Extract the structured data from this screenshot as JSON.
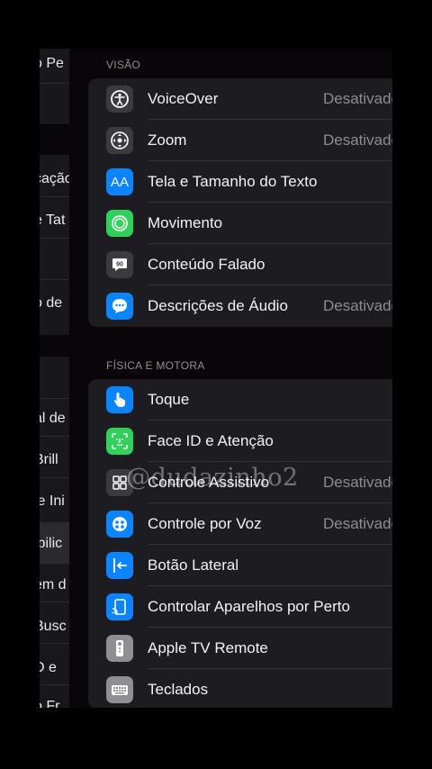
{
  "sidebar": {
    "items": [
      {
        "label": "o Pe"
      },
      {
        "label": "cação"
      },
      {
        "label": "e Tat"
      },
      {
        "label": "o de"
      },
      {
        "label": "al de"
      },
      {
        "label": "Brill"
      },
      {
        "label": "le Ini"
      },
      {
        "label": "ibilic"
      },
      {
        "label": "em d"
      },
      {
        "label": "Busc"
      },
      {
        "label": "D e"
      },
      {
        "label": "o Fr"
      }
    ]
  },
  "sections": [
    {
      "header": "VISÃO",
      "rows": [
        {
          "label": "VoiceOver",
          "value": "Desativado",
          "icon": "voiceover-icon",
          "color": "#3a3a3f"
        },
        {
          "label": "Zoom",
          "value": "Desativado",
          "icon": "zoom-icon",
          "color": "#3a3a3f"
        },
        {
          "label": "Tela e Tamanho do Texto",
          "value": "",
          "icon": "text-size-icon",
          "color": "#0a84ff"
        },
        {
          "label": "Movimento",
          "value": "",
          "icon": "motion-icon",
          "color": "#30d158"
        },
        {
          "label": "Conteúdo Falado",
          "value": "",
          "icon": "spoken-content-icon",
          "color": "#3a3a3f"
        },
        {
          "label": "Descrições de Áudio",
          "value": "Desativado",
          "icon": "audio-description-icon",
          "color": "#0a84ff"
        }
      ]
    },
    {
      "header": "FÍSICA E MOTORA",
      "rows": [
        {
          "label": "Toque",
          "value": "",
          "icon": "touch-icon",
          "color": "#0a84ff"
        },
        {
          "label": "Face ID e Atenção",
          "value": "",
          "icon": "face-id-icon",
          "color": "#30d158"
        },
        {
          "label": "Controle Assistivo",
          "value": "Desativado",
          "icon": "switch-control-icon",
          "color": "#3a3a3f"
        },
        {
          "label": "Controle por Voz",
          "value": "Desativado",
          "icon": "voice-control-icon",
          "color": "#0a84ff"
        },
        {
          "label": "Botão Lateral",
          "value": "",
          "icon": "side-button-icon",
          "color": "#0a84ff"
        },
        {
          "label": "Controlar Aparelhos por Perto",
          "value": "",
          "icon": "nearby-devices-icon",
          "color": "#0a84ff"
        },
        {
          "label": "Apple TV Remote",
          "value": "",
          "icon": "tv-remote-icon",
          "color": "#8e8e93"
        },
        {
          "label": "Teclados",
          "value": "",
          "icon": "keyboard-icon",
          "color": "#8e8e93"
        }
      ]
    }
  ],
  "watermark": "@dudazinho2"
}
